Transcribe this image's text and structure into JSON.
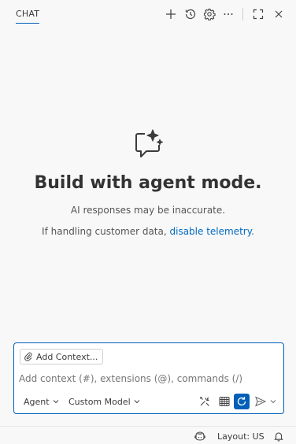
{
  "header": {
    "tab_label": "CHAT",
    "icons": [
      "plus-icon",
      "history-icon",
      "gear-icon",
      "more-icon",
      "maximize-icon",
      "close-icon"
    ]
  },
  "welcome": {
    "icon": "chat-sparkle-icon",
    "title": "Build with agent mode.",
    "note": "AI responses may be inaccurate.",
    "telemetry_prefix": "If handling customer data, ",
    "telemetry_link": "disable telemetry",
    "telemetry_suffix": "."
  },
  "input": {
    "add_context_label": "Add Context...",
    "placeholder": "Add context (#), extensions (@), commands (/)",
    "mode_label": "Agent",
    "model_label": "Custom Model",
    "colors": {
      "accent": "#005fb8",
      "link": "#0069c2"
    }
  },
  "statusbar": {
    "layout_label": "Layout: US"
  }
}
